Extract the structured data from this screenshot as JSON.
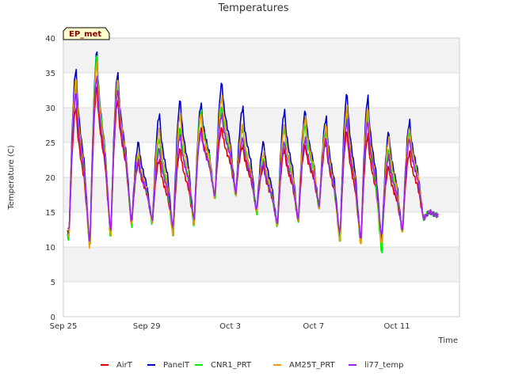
{
  "chart_data": {
    "type": "line",
    "title": "Temperatures",
    "xlabel": "Time",
    "ylabel": "Temperature (C)",
    "ylim": [
      0,
      40
    ],
    "xlim": [
      "2023-09-25",
      "2023-10-14"
    ],
    "yticks": [
      0,
      5,
      10,
      15,
      20,
      25,
      30,
      35,
      40
    ],
    "xticks": [
      {
        "label": "Sep 25",
        "day": 0
      },
      {
        "label": "Sep 29",
        "day": 4
      },
      {
        "label": "Oct 3",
        "day": 8
      },
      {
        "label": "Oct 7",
        "day": 12
      },
      {
        "label": "Oct 11",
        "day": 16
      }
    ],
    "site_label": "EP_met",
    "grid": true,
    "legend_position": "bottom",
    "daily_extremes": {
      "days": [
        "Sep 25",
        "Sep 26",
        "Sep 27",
        "Sep 28",
        "Sep 29",
        "Sep 30",
        "Oct 1",
        "Oct 2",
        "Oct 3",
        "Oct 4",
        "Oct 5",
        "Oct 6",
        "Oct 7",
        "Oct 8",
        "Oct 9",
        "Oct 10",
        "Oct 11",
        "Oct 12"
      ],
      "series": [
        {
          "name": "AirT",
          "color": "#dd0000",
          "min": [
            11.5,
            9.5,
            11.0,
            13.0,
            13.5,
            12.0,
            13.0,
            17.0,
            17.5,
            15.0,
            13.0,
            13.5,
            15.5,
            11.0,
            10.0,
            10.5,
            12.0,
            14.0
          ],
          "max": [
            30.0,
            33.0,
            31.0,
            22.0,
            22.5,
            24.0,
            27.0,
            27.0,
            24.5,
            21.5,
            24.0,
            24.5,
            25.0,
            26.5,
            26.0,
            21.5,
            23.5,
            15.0
          ]
        },
        {
          "name": "PanelT",
          "color": "#0000cc",
          "min": [
            11.0,
            9.0,
            10.5,
            12.5,
            13.0,
            11.5,
            12.5,
            16.5,
            17.0,
            14.5,
            12.5,
            13.0,
            15.0,
            10.5,
            9.5,
            10.0,
            11.5,
            14.0
          ],
          "max": [
            35.5,
            38.0,
            35.0,
            25.0,
            29.0,
            31.0,
            30.5,
            33.5,
            30.0,
            25.0,
            29.5,
            29.5,
            28.5,
            32.0,
            31.5,
            26.5,
            28.0,
            15.0
          ]
        },
        {
          "name": "CNR1_PRT",
          "color": "#00ee00",
          "min": [
            11.0,
            9.0,
            10.5,
            12.5,
            13.0,
            11.0,
            12.5,
            16.5,
            17.0,
            14.5,
            12.5,
            13.0,
            15.0,
            10.0,
            9.5,
            8.5,
            11.5,
            14.0
          ],
          "max": [
            33.0,
            37.5,
            33.0,
            23.0,
            25.5,
            27.0,
            29.5,
            30.0,
            27.0,
            22.5,
            27.0,
            27.5,
            26.5,
            29.0,
            29.0,
            24.0,
            26.5,
            15.0
          ]
        },
        {
          "name": "AM25T_PRT",
          "color": "#e69f00",
          "min": [
            11.0,
            8.8,
            10.5,
            12.5,
            13.0,
            11.0,
            12.5,
            16.5,
            17.0,
            14.5,
            12.5,
            13.0,
            15.0,
            10.0,
            9.5,
            9.5,
            11.5,
            14.0
          ],
          "max": [
            34.0,
            36.5,
            34.0,
            23.5,
            27.0,
            29.0,
            29.0,
            31.5,
            27.5,
            23.5,
            27.5,
            28.5,
            27.5,
            30.0,
            30.0,
            25.5,
            27.0,
            15.0
          ]
        },
        {
          "name": "li77_temp",
          "color": "#a020f0",
          "min": [
            12.0,
            10.0,
            11.5,
            13.0,
            13.5,
            12.5,
            13.5,
            17.0,
            17.5,
            15.0,
            13.0,
            13.5,
            15.5,
            11.5,
            10.5,
            11.0,
            12.0,
            14.0
          ],
          "max": [
            32.0,
            34.5,
            32.5,
            22.5,
            24.0,
            26.0,
            26.5,
            29.0,
            25.5,
            22.0,
            25.0,
            25.5,
            25.5,
            28.0,
            28.0,
            23.0,
            25.5,
            15.0
          ]
        }
      ]
    }
  }
}
